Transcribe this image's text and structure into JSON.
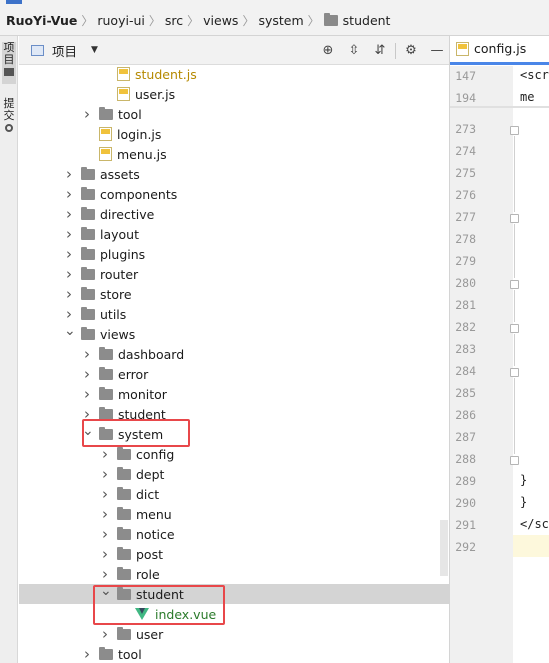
{
  "breadcrumb": {
    "items": [
      "RuoYi-Vue",
      "ruoyi-ui",
      "src",
      "views",
      "system",
      "student"
    ]
  },
  "left_strip": {
    "tabs": [
      {
        "label": "项目",
        "active": true
      },
      {
        "label": "提交",
        "active": false
      }
    ]
  },
  "project_panel": {
    "title": "项目",
    "tools": [
      "locate-icon",
      "expand-all-icon",
      "collapse-all-icon",
      "settings-icon",
      "hide-icon"
    ]
  },
  "tree": [
    {
      "label": "student.js",
      "type": "js",
      "depth": 3,
      "expanded": null
    },
    {
      "label": "user.js",
      "type": "js",
      "depth": 3,
      "expanded": null
    },
    {
      "label": "tool",
      "type": "folder",
      "depth": 2,
      "expanded": false
    },
    {
      "label": "login.js",
      "type": "js",
      "depth": 2,
      "expanded": null
    },
    {
      "label": "menu.js",
      "type": "js",
      "depth": 2,
      "expanded": null
    },
    {
      "label": "assets",
      "type": "folder",
      "depth": 1,
      "expanded": false
    },
    {
      "label": "components",
      "type": "folder",
      "depth": 1,
      "expanded": false
    },
    {
      "label": "directive",
      "type": "folder",
      "depth": 1,
      "expanded": false
    },
    {
      "label": "layout",
      "type": "folder",
      "depth": 1,
      "expanded": false
    },
    {
      "label": "plugins",
      "type": "folder",
      "depth": 1,
      "expanded": false
    },
    {
      "label": "router",
      "type": "folder",
      "depth": 1,
      "expanded": false
    },
    {
      "label": "store",
      "type": "folder",
      "depth": 1,
      "expanded": false
    },
    {
      "label": "utils",
      "type": "folder",
      "depth": 1,
      "expanded": false
    },
    {
      "label": "views",
      "type": "folder",
      "depth": 1,
      "expanded": true
    },
    {
      "label": "dashboard",
      "type": "folder",
      "depth": 2,
      "expanded": false
    },
    {
      "label": "error",
      "type": "folder",
      "depth": 2,
      "expanded": false
    },
    {
      "label": "monitor",
      "type": "folder",
      "depth": 2,
      "expanded": false
    },
    {
      "label": "student",
      "type": "folder",
      "depth": 2,
      "expanded": false
    },
    {
      "label": "system",
      "type": "folder",
      "depth": 2,
      "expanded": true
    },
    {
      "label": "config",
      "type": "folder",
      "depth": 3,
      "expanded": false
    },
    {
      "label": "dept",
      "type": "folder",
      "depth": 3,
      "expanded": false
    },
    {
      "label": "dict",
      "type": "folder",
      "depth": 3,
      "expanded": false
    },
    {
      "label": "menu",
      "type": "folder",
      "depth": 3,
      "expanded": false
    },
    {
      "label": "notice",
      "type": "folder",
      "depth": 3,
      "expanded": false
    },
    {
      "label": "post",
      "type": "folder",
      "depth": 3,
      "expanded": false
    },
    {
      "label": "role",
      "type": "folder",
      "depth": 3,
      "expanded": false
    },
    {
      "label": "student",
      "type": "folder",
      "depth": 3,
      "expanded": true,
      "selected": true
    },
    {
      "label": "index.vue",
      "type": "vue",
      "depth": 4,
      "expanded": null
    },
    {
      "label": "user",
      "type": "folder",
      "depth": 3,
      "expanded": false
    },
    {
      "label": "tool",
      "type": "folder",
      "depth": 2,
      "expanded": false
    }
  ],
  "editor": {
    "tab_label": "config.js",
    "sticky_lines": [
      {
        "num": "147",
        "text": "<scr"
      },
      {
        "num": "194",
        "text": "  me"
      }
    ],
    "lines": [
      {
        "num": "273",
        "text": ""
      },
      {
        "num": "274",
        "text": ""
      },
      {
        "num": "275",
        "text": ""
      },
      {
        "num": "276",
        "text": ""
      },
      {
        "num": "277",
        "text": ""
      },
      {
        "num": "278",
        "text": ""
      },
      {
        "num": "279",
        "text": ""
      },
      {
        "num": "280",
        "text": ""
      },
      {
        "num": "281",
        "text": ""
      },
      {
        "num": "282",
        "text": ""
      },
      {
        "num": "283",
        "text": ""
      },
      {
        "num": "284",
        "text": ""
      },
      {
        "num": "285",
        "text": ""
      },
      {
        "num": "286",
        "text": ""
      },
      {
        "num": "287",
        "text": ""
      },
      {
        "num": "288",
        "text": ""
      },
      {
        "num": "289",
        "text": "  }"
      },
      {
        "num": "290",
        "text": "}"
      },
      {
        "num": "291",
        "text": "</sc"
      },
      {
        "num": "292",
        "text": ""
      }
    ]
  },
  "colors": {
    "highlight_box": "#e8474a",
    "accent": "#4a86e8",
    "selected_row": "#d4d4d4"
  }
}
